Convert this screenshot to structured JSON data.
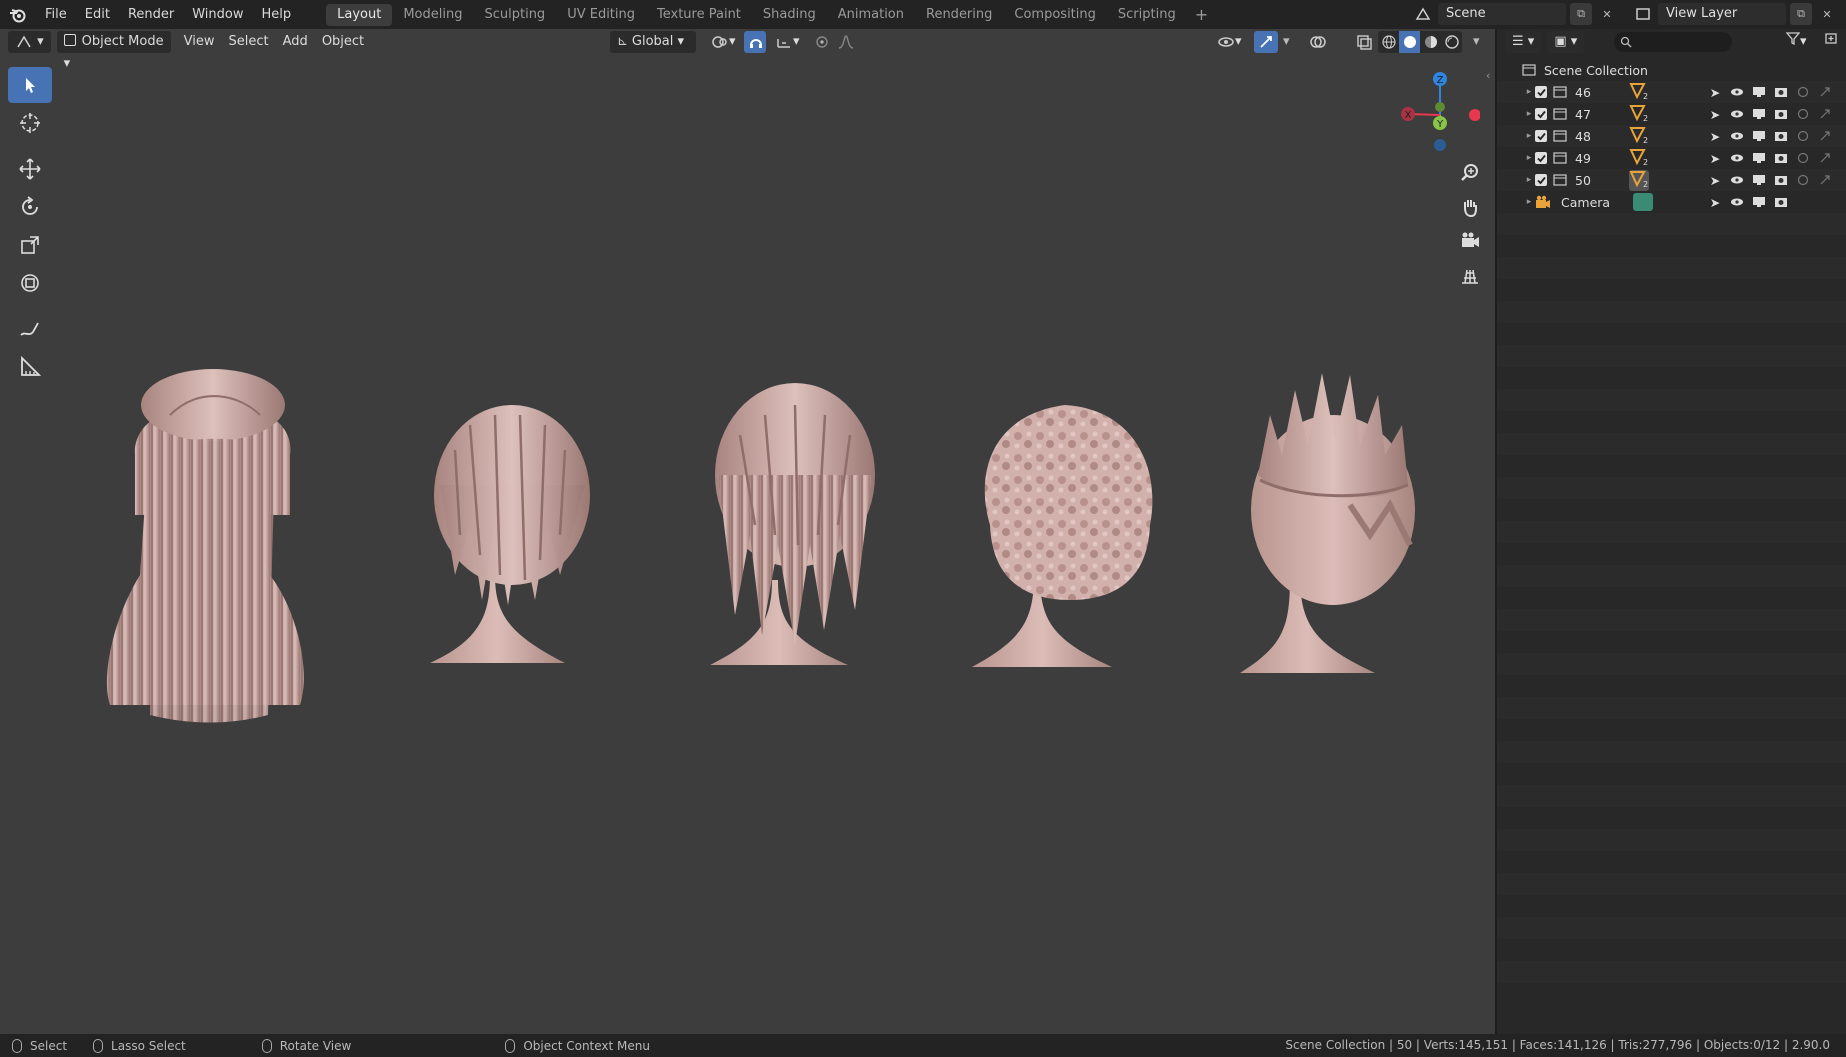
{
  "menu": {
    "items": [
      "File",
      "Edit",
      "Render",
      "Window",
      "Help"
    ]
  },
  "workspaces": {
    "tabs": [
      "Layout",
      "Modeling",
      "Sculpting",
      "UV Editing",
      "Texture Paint",
      "Shading",
      "Animation",
      "Rendering",
      "Compositing",
      "Scripting"
    ],
    "active": "Layout",
    "add_label": "+"
  },
  "scene": {
    "label": "Scene"
  },
  "view_layer": {
    "label": "View Layer"
  },
  "viewport_header": {
    "mode": "Object Mode",
    "view": "View",
    "select": "Select",
    "add": "Add",
    "object": "Object",
    "orientation": "Global"
  },
  "gizmo": {
    "z": "Z",
    "y": "Y",
    "x": "X"
  },
  "outliner": {
    "root": "Scene Collection",
    "items": [
      {
        "name": "46",
        "badge": "2"
      },
      {
        "name": "47",
        "badge": "2"
      },
      {
        "name": "48",
        "badge": "2"
      },
      {
        "name": "49",
        "badge": "2"
      },
      {
        "name": "50",
        "badge": "2"
      }
    ],
    "camera": "Camera"
  },
  "statusbar": {
    "select": "Select",
    "lasso": "Lasso Select",
    "rotate": "Rotate View",
    "context": "Object Context Menu",
    "stats": "Scene Collection | 50 | Verts:145,151 | Faces:141,126 | Tris:277,796 | Objects:0/12 | 2.90.0"
  },
  "colors": {
    "accent": "#4772b3",
    "viewport_bg": "#3d3d3d",
    "head_skin": "#d9b8b4",
    "axis_x": "#e8384f",
    "axis_y": "#8bc34a",
    "axis_z": "#2e86de"
  }
}
